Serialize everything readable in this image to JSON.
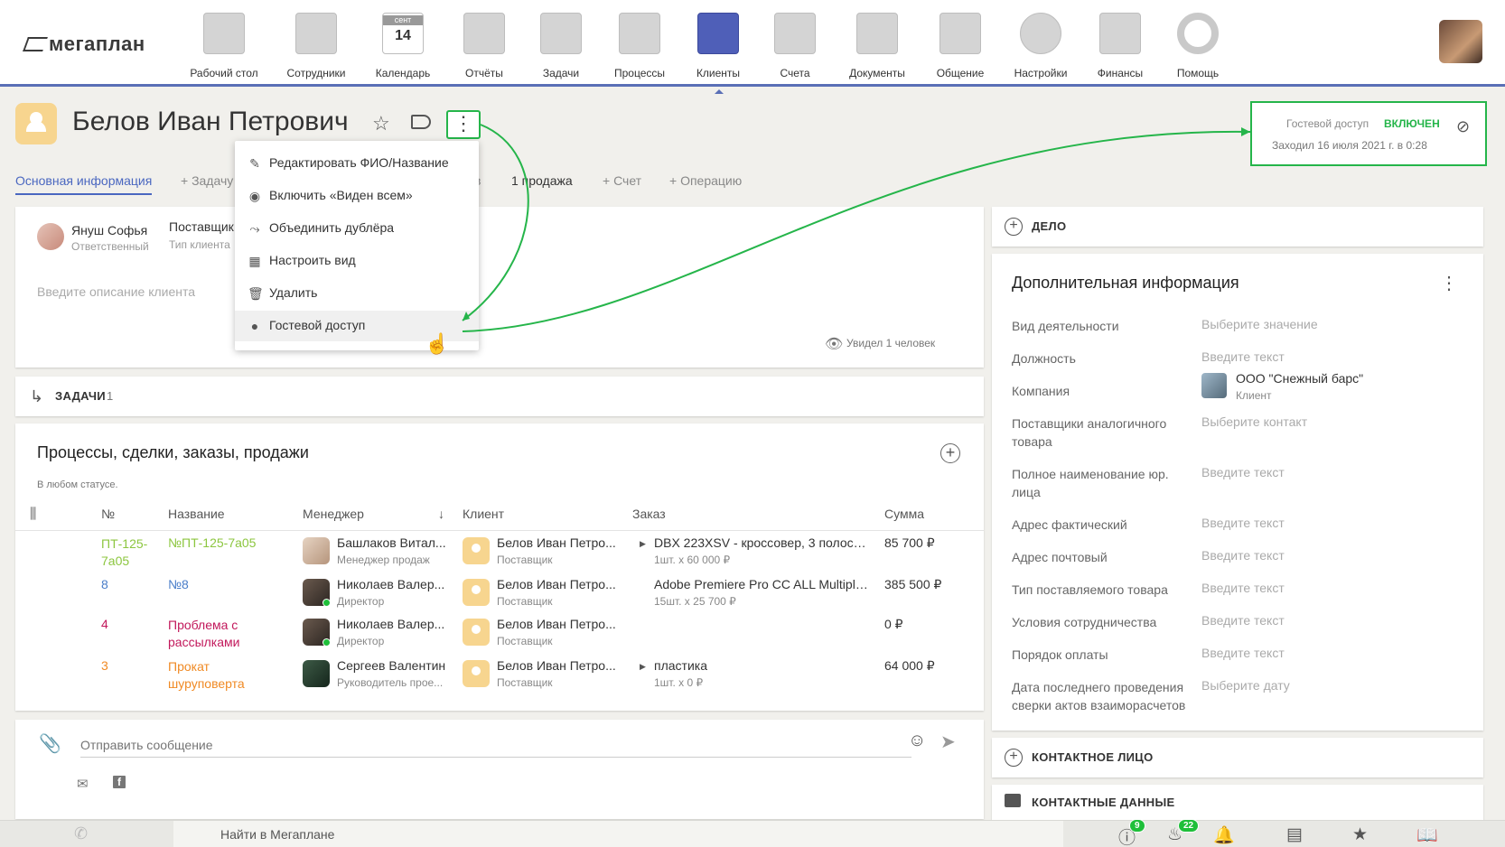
{
  "app": {
    "logo": "мегаплан"
  },
  "nav": [
    {
      "label": "Рабочий стол",
      "icon": "desktop-icon"
    },
    {
      "label": "Сотрудники",
      "icon": "employees-icon"
    },
    {
      "label": "Календарь",
      "icon": "calendar-icon",
      "cal_month": "сент",
      "cal_day": "14"
    },
    {
      "label": "Отчёты",
      "icon": "reports-icon"
    },
    {
      "label": "Задачи",
      "icon": "tasks-icon"
    },
    {
      "label": "Процессы",
      "icon": "processes-icon"
    },
    {
      "label": "Клиенты",
      "icon": "clients-icon",
      "active": true
    },
    {
      "label": "Счета",
      "icon": "invoices-icon"
    },
    {
      "label": "Документы",
      "icon": "documents-icon"
    },
    {
      "label": "Общение",
      "icon": "chat-icon"
    },
    {
      "label": "Настройки",
      "icon": "settings-icon"
    },
    {
      "label": "Финансы",
      "icon": "finance-icon"
    },
    {
      "label": "Помощь",
      "icon": "help-icon"
    }
  ],
  "client": {
    "name": "Белов Иван Петрович"
  },
  "guest": {
    "label": "Гостевой доступ",
    "status": "ВКЛЮЧЕН",
    "visited": "Заходил 16 июля 2021 г. в 0:28"
  },
  "tabs": [
    {
      "label": "Основная информация",
      "active": true
    },
    {
      "label": "+ Задачу"
    },
    {
      "label": "в"
    },
    {
      "label": "1 продажа"
    },
    {
      "label": "+ Счет"
    },
    {
      "label": "+ Операцию"
    }
  ],
  "info": {
    "responsible_name": "Януш Софья",
    "responsible_role": "Ответственный",
    "client_type": "Поставщик",
    "client_type_label": "Тип клиента",
    "desc_placeholder": "Введите описание клиента",
    "seen": "Увидел 1 человек"
  },
  "menu": [
    {
      "label": "Редактировать ФИО/Название",
      "icon": "✎"
    },
    {
      "label": "Включить «Виден всем»",
      "icon": "◉"
    },
    {
      "label": "Объединить дублёра",
      "icon": "⤳"
    },
    {
      "label": "Настроить вид",
      "icon": "▦"
    },
    {
      "label": "Удалить",
      "icon": "🗑"
    },
    {
      "label": "Гостевой доступ",
      "icon": "●"
    }
  ],
  "tasks": {
    "label": "ЗАДАЧИ",
    "count": "1"
  },
  "processes": {
    "title": "Процессы, сделки, заказы, продажи",
    "subtitle": "В любом статусе.",
    "headers": {
      "num": "№",
      "name": "Название",
      "manager": "Менеджер",
      "client": "Клиент",
      "order": "Заказ",
      "sum": "Сумма"
    },
    "rows": [
      {
        "num": "ПТ-125-7a05",
        "name": "№ПТ-125-7a05",
        "color": "#8cc63f",
        "manager": "Башлаков Витал...",
        "manager_role": "Менеджер продаж",
        "client": "Белов Иван Петро...",
        "client_role": "Поставщик",
        "order": "DBX 223XSV - кроссовер, 3 полосы...",
        "order_sub": "1шт. x 60 000 ₽",
        "order_arrow": true,
        "sum": "85 700 ₽"
      },
      {
        "num": "8",
        "name": "№8",
        "color": "#4a7ec9",
        "manager": "Николаев Валер...",
        "manager_role": "Директор",
        "client": "Белов Иван Петро...",
        "client_role": "Поставщик",
        "order": "Adobe Premiere Pro CC ALL Multiple...",
        "order_sub": "15шт. x 25 700 ₽",
        "order_arrow": false,
        "sum": "385 500 ₽"
      },
      {
        "num": "4",
        "name": "Проблема с рассылками",
        "color": "#c2185b",
        "manager": "Николаев Валер...",
        "manager_role": "Директор",
        "client": "Белов Иван Петро...",
        "client_role": "Поставщик",
        "order": "",
        "order_sub": "",
        "order_arrow": false,
        "sum": "0 ₽"
      },
      {
        "num": "3",
        "name": "Прокат шуруповерта",
        "color": "#f08a24",
        "manager": "Сергеев Валентин",
        "manager_role": "Руководитель прое...",
        "client": "Белов Иван Петро...",
        "client_role": "Поставщик",
        "order": "пластика",
        "order_sub": "1шт. x 0 ₽",
        "order_arrow": true,
        "sum": "64 000 ₽"
      }
    ]
  },
  "message": {
    "placeholder": "Отправить сообщение"
  },
  "right": {
    "deal": "ДЕЛО",
    "extra_title": "Дополнительная информация",
    "fields": [
      {
        "label": "Вид деятельности",
        "value": "Выберите значение"
      },
      {
        "label": "Должность",
        "value": "Введите текст"
      },
      {
        "label": "Компания",
        "value": ""
      },
      {
        "label": "Поставщики аналогичного товара",
        "value": "Выберите контакт"
      },
      {
        "label": "Полное наименование юр. лица",
        "value": "Введите текст"
      },
      {
        "label": "Адрес фактический",
        "value": "Введите текст"
      },
      {
        "label": "Адрес почтовый",
        "value": "Введите текст"
      },
      {
        "label": "Тип поставляемого товара",
        "value": "Введите текст"
      },
      {
        "label": "Условия сотрудничества",
        "value": "Введите текст"
      },
      {
        "label": "Порядок оплаты",
        "value": "Введите текст"
      },
      {
        "label": "Дата последнего проведения сверки актов взаиморасчетов",
        "value": "Выберите дату"
      }
    ],
    "company_name": "ООО \"Снежный барс\"",
    "company_type": "Клиент",
    "contact_person": "КОНТАКТНОЕ ЛИЦО",
    "contact_data": "КОНТАКТНЫЕ ДАННЫЕ"
  },
  "bottom": {
    "search": "Найти в Мегаплане",
    "alerts_badge": "9",
    "fire_badge": "22"
  },
  "colors": {
    "accent": "#4a67c0",
    "highlight": "#25b54a"
  }
}
